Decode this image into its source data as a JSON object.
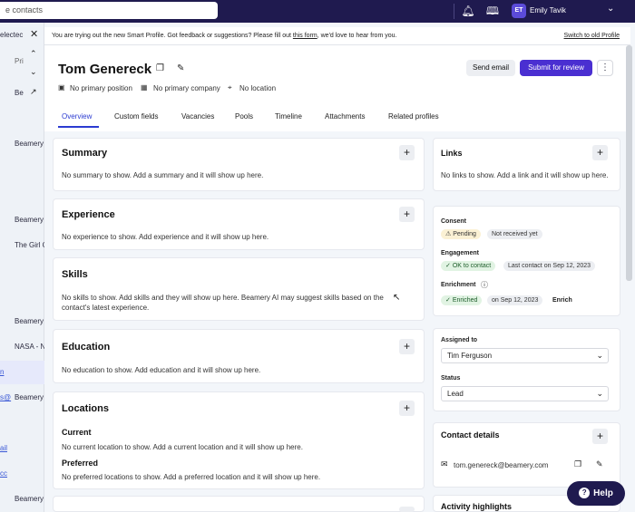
{
  "topbar": {
    "search_placeholder": "e contacts",
    "avatar_initials": "ET",
    "user_name": "Emily Tavik"
  },
  "left_list": {
    "selected_text": "electec",
    "filter_text": "Pri",
    "items": [
      "Be",
      "Beamery",
      "Beamery",
      "The Girl C",
      "Beamery",
      "NASA - N",
      "Beamery",
      "Beamery"
    ],
    "links": [
      "n",
      "s@",
      "ail",
      "cc"
    ]
  },
  "banner": {
    "text_before": "You are trying out the new Smart Profile. Got feedback or suggestions? Please fill out ",
    "link": "this form",
    "text_after": ", we'd love to hear from you.",
    "switch": "Switch to old Profile"
  },
  "profile": {
    "name": "Tom Genereck",
    "position": "No primary position",
    "company": "No primary company",
    "location": "No location"
  },
  "actions": {
    "send_email": "Send email",
    "submit_review": "Submit for review"
  },
  "tabs": [
    "Overview",
    "Custom fields",
    "Vacancies",
    "Pools",
    "Timeline",
    "Attachments",
    "Related profiles"
  ],
  "sections": {
    "summary": {
      "title": "Summary",
      "text": "No summary to show. Add a summary and it will show up here."
    },
    "experience": {
      "title": "Experience",
      "text": "No experience to show. Add experience and it will show up here."
    },
    "skills": {
      "title": "Skills",
      "text1": "No skills to show. Add skills and they will show up here. Beamery AI may suggest skills based on the",
      "text2": "contact's latest experience."
    },
    "education": {
      "title": "Education",
      "text": "No education to show. Add education and it will show up here."
    },
    "locations": {
      "title": "Locations",
      "current_label": "Current",
      "current_text": "No current location to show. Add a current location and it will show up here.",
      "preferred_label": "Preferred",
      "preferred_text": "No preferred locations to show. Add a preferred location and it will show up here."
    }
  },
  "links_card": {
    "title": "Links",
    "text": "No links to show. Add a link and it will show up here."
  },
  "status_card": {
    "consent_label": "Consent",
    "consent_pending": "Pending",
    "consent_status": "Not received yet",
    "engagement_label": "Engagement",
    "engagement_ok": "OK to contact",
    "engagement_last": "Last contact on Sep 12, 2023",
    "enrichment_label": "Enrichment",
    "enrichment_status": "Enriched",
    "enrichment_date": "on Sep 12, 2023",
    "enrich_action": "Enrich"
  },
  "assign_card": {
    "assigned_label": "Assigned to",
    "assigned_value": "Tim Ferguson",
    "status_label": "Status",
    "status_value": "Lead"
  },
  "contact_card": {
    "title": "Contact details",
    "email": "tom.genereck@beamery.com"
  },
  "activity": {
    "title": "Activity highlights"
  },
  "help": {
    "label": "Help"
  },
  "colors": {
    "brand": "#1f1a4f",
    "primary_button": "#4a2fd1",
    "active_tab": "#2b3bd1"
  }
}
